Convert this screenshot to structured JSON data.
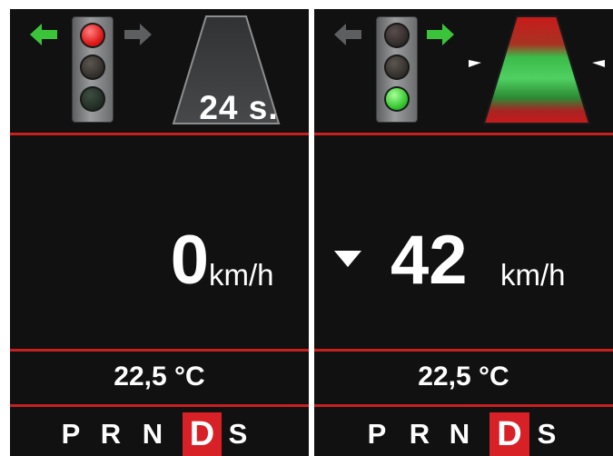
{
  "colors": {
    "screen_bg": "#111112",
    "accent_red": "#c8201f",
    "active_gear_bg": "#d82027",
    "arrow_green": "#3bc43a",
    "arrow_gray": "#5c5e60"
  },
  "left_panel": {
    "left_arrow": {
      "icon": "arrow-left-icon",
      "color": "green"
    },
    "right_arrow": {
      "icon": "arrow-right-icon",
      "color": "gray"
    },
    "traffic_light": {
      "active_lamp": "red"
    },
    "countdown": "24 s.",
    "speed_value": "0",
    "speed_unit": "km/h",
    "temperature": "22,5 °C",
    "gears": [
      "P",
      "R",
      "N",
      "D",
      "S"
    ],
    "active_gear": "D"
  },
  "right_panel": {
    "left_arrow": {
      "icon": "arrow-left-icon",
      "color": "gray"
    },
    "right_arrow": {
      "icon": "arrow-right-icon",
      "color": "green"
    },
    "traffic_light": {
      "active_lamp": "green"
    },
    "speed_indicator": "down-triangle-icon",
    "speed_value": "42",
    "speed_unit": "km/h",
    "temperature": "22,5 °C",
    "gears": [
      "P",
      "R",
      "N",
      "D",
      "S"
    ],
    "active_gear": "D"
  }
}
